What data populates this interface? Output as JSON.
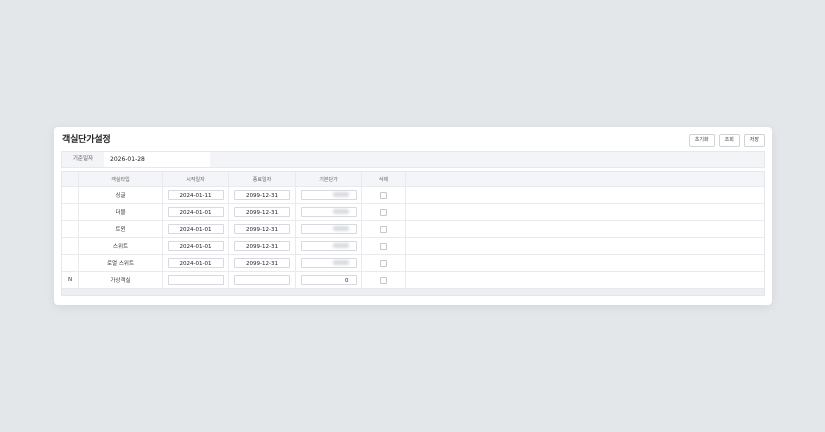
{
  "page": {
    "title": "객실단가설정"
  },
  "toolbar": {
    "reset_label": "초기화",
    "search_label": "조회",
    "save_label": "저장"
  },
  "filter": {
    "label": "기준일자",
    "value": "2026-01-28"
  },
  "grid": {
    "columns": {
      "type": "객실타입",
      "start": "시작일자",
      "end": "종료일자",
      "price": "기본단가",
      "delete": "삭제"
    },
    "rows": [
      {
        "state": "",
        "type": "싱글",
        "start": "2024-01-11",
        "end": "2099-12-31",
        "price_redacted": true,
        "price": ""
      },
      {
        "state": "",
        "type": "더블",
        "start": "2024-01-01",
        "end": "2099-12-31",
        "price_redacted": true,
        "price": ""
      },
      {
        "state": "",
        "type": "트윈",
        "start": "2024-01-01",
        "end": "2099-12-31",
        "price_redacted": true,
        "price": ""
      },
      {
        "state": "",
        "type": "스위트",
        "start": "2024-01-01",
        "end": "2099-12-31",
        "price_redacted": true,
        "price": ""
      },
      {
        "state": "",
        "type": "로열 스위트",
        "start": "2024-01-01",
        "end": "2099-12-31",
        "price_redacted": true,
        "price": ""
      },
      {
        "state": "N",
        "type": "가상객실",
        "start": "",
        "end": "",
        "price_redacted": false,
        "price": "0"
      }
    ]
  }
}
